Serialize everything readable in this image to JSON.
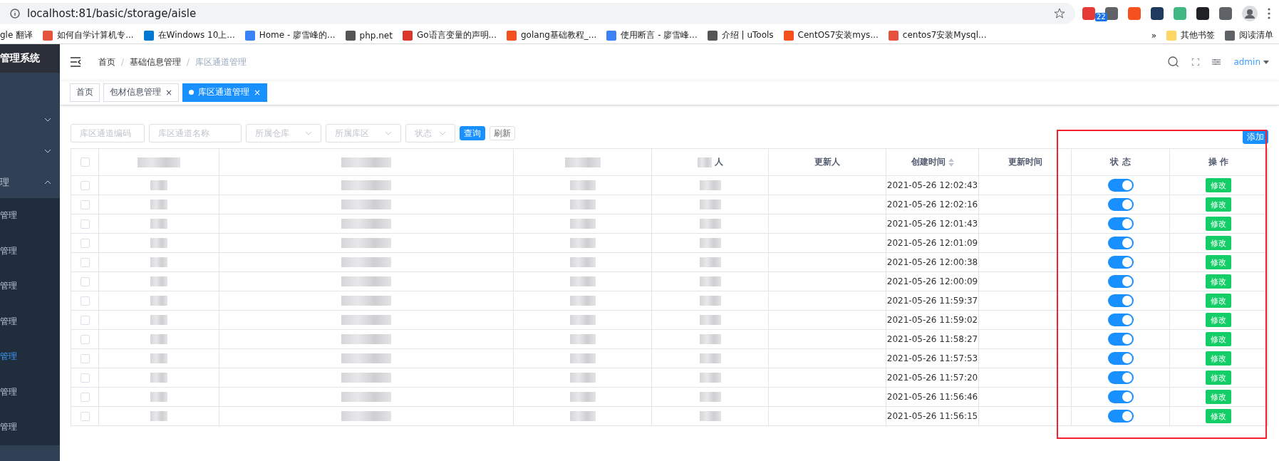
{
  "browser": {
    "url": "localhost:81/basic/storage/aisle",
    "extension_badge": "22",
    "bookmarks": [
      {
        "label": "gle 翻译"
      },
      {
        "label": "如何自学计算机专...",
        "color": "#e5533d"
      },
      {
        "label": "在Windows 10上...",
        "color": "#0078d4"
      },
      {
        "label": "Home - 廖雪峰的...",
        "color": "#3b82f6"
      },
      {
        "label": "php.net",
        "color": "#555555"
      },
      {
        "label": "Go语言变量的声明...",
        "color": "#d9372b"
      },
      {
        "label": "golang基础教程_...",
        "color": "#f4511e"
      },
      {
        "label": "使用断言 - 廖雪峰...",
        "color": "#3b82f6"
      },
      {
        "label": "介绍 | uTools",
        "color": "#555555"
      },
      {
        "label": "CentOS7安装mys...",
        "color": "#f4511e"
      },
      {
        "label": "centos7安装Mysql...",
        "color": "#e5533d"
      }
    ],
    "more": "»",
    "other_bookmarks": "其他书签",
    "reading_list": "阅读清单"
  },
  "sidebar": {
    "title": "管理系统",
    "items": [
      {
        "expanded": false
      },
      {
        "expanded": false
      },
      {
        "label": "理",
        "expanded": true,
        "children": [
          {
            "label": "管理",
            "selected": false
          },
          {
            "label": "管理",
            "selected": false
          },
          {
            "label": "管理",
            "selected": false
          },
          {
            "label": "管理",
            "selected": false
          },
          {
            "label": "管理",
            "selected": true
          },
          {
            "label": "管理",
            "selected": false
          },
          {
            "label": "管理",
            "selected": false
          }
        ]
      }
    ]
  },
  "breadcrumb": [
    "首页",
    "基础信息管理",
    "库区通道管理"
  ],
  "breadcrumb_separator": "/",
  "user": "admin",
  "tabs": [
    {
      "label": "首页",
      "selected": false,
      "closable": false
    },
    {
      "label": "包材信息管理",
      "selected": false,
      "closable": true
    },
    {
      "label": "库区通道管理",
      "selected": true,
      "closable": true
    }
  ],
  "close_mark": "×",
  "filters": [
    {
      "kind": "input",
      "placeholder": "库区通道编码"
    },
    {
      "kind": "input",
      "placeholder": "库区通道名称"
    },
    {
      "kind": "select",
      "placeholder": "所属仓库"
    },
    {
      "kind": "select",
      "placeholder": "所属库区"
    },
    {
      "kind": "select",
      "placeholder": "状态"
    }
  ],
  "query_button": "查询",
  "refresh_button": "刷新",
  "add_button": "添加",
  "table": {
    "header_checked": false,
    "columns": [
      {
        "kind": "check"
      },
      {
        "kind": "redacted"
      },
      {
        "kind": "redacted"
      },
      {
        "kind": "redacted"
      },
      {
        "kind": "partial",
        "label": "人"
      },
      {
        "kind": "text",
        "label": "更新人"
      },
      {
        "kind": "sort",
        "label": "创建时间"
      },
      {
        "kind": "text",
        "label": "更新时间"
      },
      {
        "kind": "text",
        "label": "状 态"
      },
      {
        "kind": "text",
        "label": "操 作"
      }
    ],
    "rows": [
      {
        "checked": false,
        "created": "2021-05-26 12:02:43",
        "on": true,
        "action": "修改"
      },
      {
        "checked": false,
        "created": "2021-05-26 12:02:16",
        "on": true,
        "action": "修改"
      },
      {
        "checked": false,
        "created": "2021-05-26 12:01:43",
        "on": true,
        "action": "修改"
      },
      {
        "checked": false,
        "created": "2021-05-26 12:01:09",
        "on": true,
        "action": "修改"
      },
      {
        "checked": false,
        "created": "2021-05-26 12:00:38",
        "on": true,
        "action": "修改"
      },
      {
        "checked": false,
        "created": "2021-05-26 12:00:09",
        "on": true,
        "action": "修改"
      },
      {
        "checked": false,
        "created": "2021-05-26 11:59:37",
        "on": true,
        "action": "修改"
      },
      {
        "checked": false,
        "created": "2021-05-26 11:59:02",
        "on": true,
        "action": "修改"
      },
      {
        "checked": false,
        "created": "2021-05-26 11:58:27",
        "on": true,
        "action": "修改"
      },
      {
        "checked": false,
        "created": "2021-05-26 11:57:53",
        "on": true,
        "action": "修改"
      },
      {
        "checked": false,
        "created": "2021-05-26 11:57:20",
        "on": true,
        "action": "修改"
      },
      {
        "checked": false,
        "created": "2021-05-26 11:56:46",
        "on": true,
        "action": "修改"
      },
      {
        "checked": false,
        "created": "2021-05-26 11:56:15",
        "on": true,
        "action": "修改"
      }
    ]
  }
}
